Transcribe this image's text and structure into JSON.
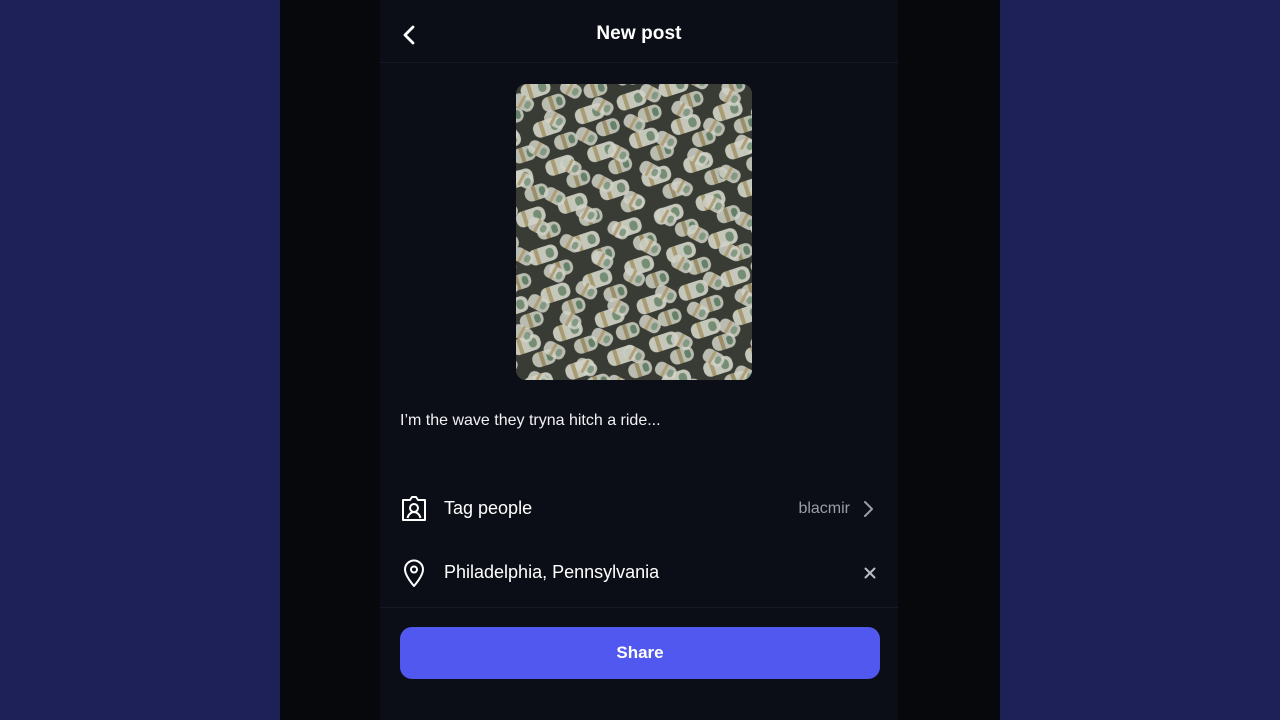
{
  "header": {
    "title": "New post",
    "back_icon": "chevron-left-icon"
  },
  "post": {
    "image_subject": "rolled hundred-dollar bills",
    "caption": "I’m the wave they tryna hitch a ride..."
  },
  "options": {
    "tag_people": {
      "icon": "tag-person-icon",
      "label": "Tag people",
      "value": "blacmir",
      "chevron": "chevron-right-icon"
    },
    "location": {
      "icon": "location-pin-icon",
      "label": "Philadelphia, Pennsylvania",
      "clear_icon": "close-icon"
    }
  },
  "actions": {
    "share_label": "Share"
  },
  "colors": {
    "background": "#1d2157",
    "panel": "#0b0e17",
    "accent": "#5058ef",
    "muted_text": "#9a9ca6"
  }
}
